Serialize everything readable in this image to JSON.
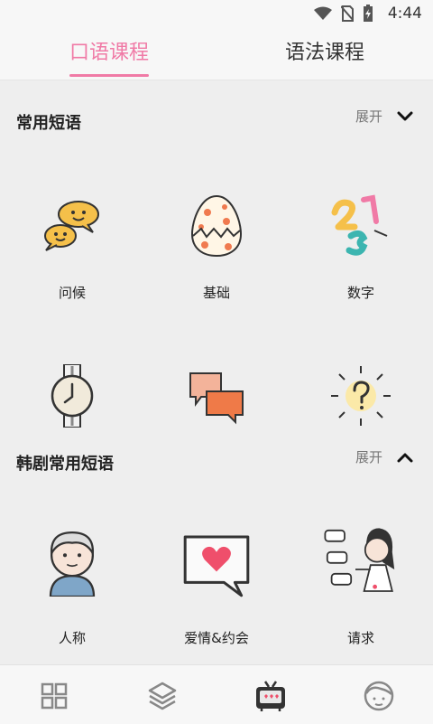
{
  "status_bar": {
    "time": "4:44",
    "icons": [
      "wifi-icon",
      "no-sim-icon",
      "battery-charging-icon"
    ]
  },
  "tabs": [
    {
      "label": "口语课程",
      "active": true
    },
    {
      "label": "语法课程",
      "active": false
    }
  ],
  "sections": [
    {
      "title": "常用短语",
      "toggle_label": "展开",
      "toggle_icon": "chevron-down-icon",
      "items": [
        {
          "label": "问候",
          "icon": "speech-bubbles-icon"
        },
        {
          "label": "基础",
          "icon": "egg-icon"
        },
        {
          "label": "数字",
          "icon": "numbers-icon"
        },
        {
          "label": "",
          "icon": "watch-icon"
        },
        {
          "label": "",
          "icon": "chat-cards-icon"
        },
        {
          "label": "",
          "icon": "question-bulb-icon"
        }
      ]
    },
    {
      "title": "韩剧常用短语",
      "toggle_label": "展开",
      "toggle_icon": "chevron-up-icon",
      "items": [
        {
          "label": "人称",
          "icon": "boy-avatar-icon"
        },
        {
          "label": "爱情&约会",
          "icon": "heart-message-icon"
        },
        {
          "label": "请求",
          "icon": "girl-asking-icon"
        }
      ]
    }
  ],
  "bottom_nav": [
    {
      "icon": "grid-icon",
      "active": false
    },
    {
      "icon": "layers-icon",
      "active": false
    },
    {
      "icon": "tv-icon",
      "active": true
    },
    {
      "icon": "profile-face-icon",
      "active": false
    }
  ],
  "colors": {
    "accent": "#f07aa6",
    "background": "#eeeeee",
    "bar": "#f7f7f7"
  }
}
